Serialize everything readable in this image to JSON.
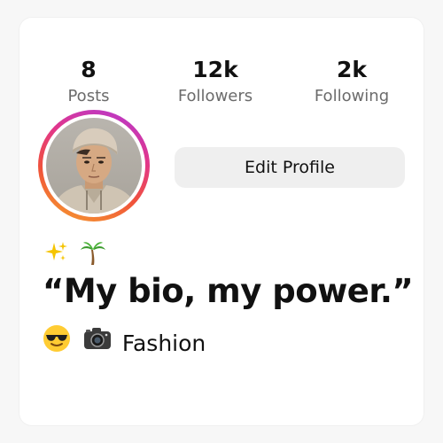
{
  "stats": {
    "posts": {
      "value": "8",
      "label": "Posts"
    },
    "followers": {
      "value": "12k",
      "label": "Followers"
    },
    "following": {
      "value": "2k",
      "label": "Following"
    }
  },
  "profile": {
    "edit_button_label": "Edit Profile",
    "avatar_ring_colors": [
      "#b13ad6",
      "#e2368a",
      "#f0533a",
      "#f6a12e"
    ]
  },
  "bio": {
    "emoji_line_icons": [
      "sparkles-icon",
      "palm-tree-icon"
    ],
    "text": "“My bio, my power.”",
    "tag_icons": [
      "sunglasses-face-icon",
      "camera-icon"
    ],
    "tag_text": "Fashion"
  }
}
